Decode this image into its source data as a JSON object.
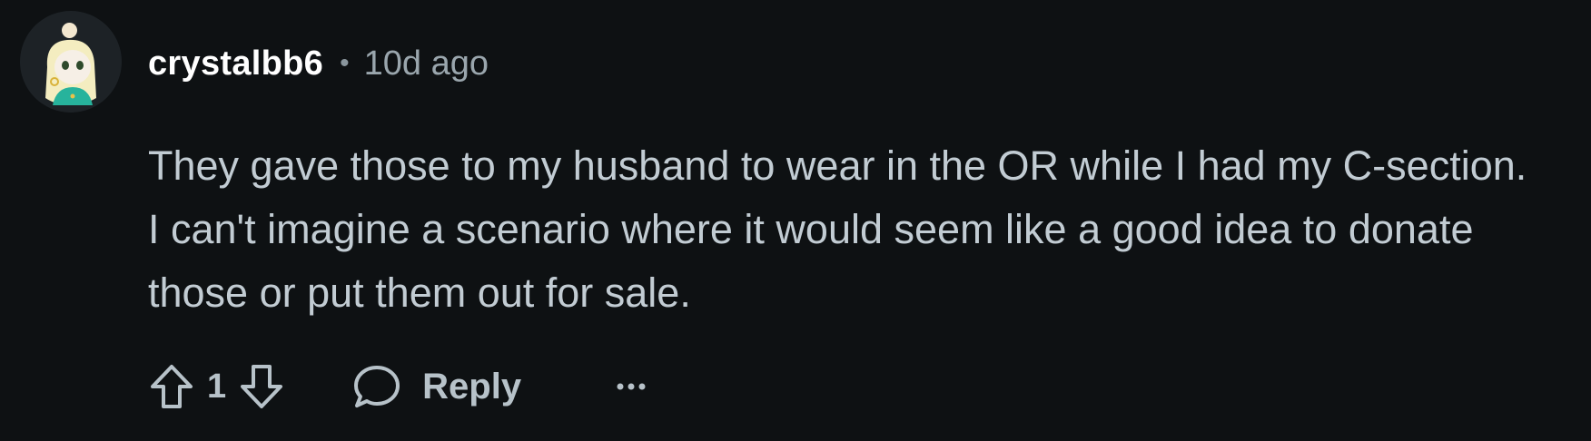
{
  "comment": {
    "author": "crystalbb6",
    "separator": "•",
    "timestamp": "10d ago",
    "body": "They gave those to my husband to wear in the OR while I had my C-section. I can't imagine a scenario where it would seem like a good idea to donate those or put them out for sale.",
    "vote_count": "1",
    "reply_label": "Reply"
  },
  "icons": {
    "avatar": "avatar-icon",
    "upvote": "upvote-arrow-icon",
    "downvote": "downvote-arrow-icon",
    "reply": "speech-bubble-icon",
    "more": "ellipsis-icon"
  },
  "colors": {
    "background": "#0e1113",
    "username": "#ffffff",
    "text": "#c2ccd3",
    "muted": "#9aa6ad"
  }
}
